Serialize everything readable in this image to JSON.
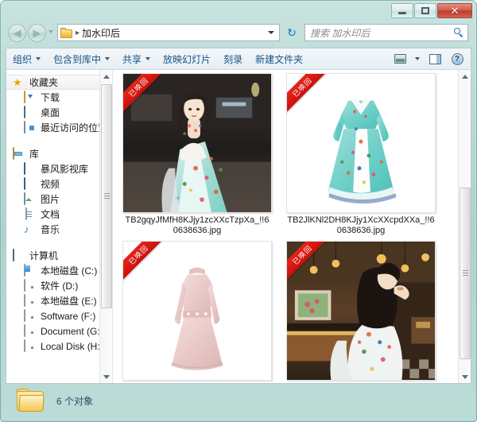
{
  "window": {
    "caption_buttons": {
      "minimize": "—",
      "maximize": "❐",
      "close": "✕"
    }
  },
  "address": {
    "back_glyph": "◀",
    "forward_glyph": "▶",
    "folder_icon": "folder-icon",
    "separator": "▸",
    "path": "加水印后",
    "refresh_glyph": "↻"
  },
  "search": {
    "placeholder": "搜索 加水印后",
    "value": "",
    "icon": "search-icon"
  },
  "toolbar": {
    "items": [
      {
        "label": "组织",
        "has_caret": true
      },
      {
        "label": "包含到库中",
        "has_caret": true
      },
      {
        "label": "共享",
        "has_caret": true
      },
      {
        "label": "放映幻灯片",
        "has_caret": false
      },
      {
        "label": "刻录",
        "has_caret": false
      },
      {
        "label": "新建文件夹",
        "has_caret": false
      }
    ],
    "view_icon": "view-options-icon",
    "view_caret": "chevron-down-icon",
    "preview_pane_icon": "preview-pane-icon",
    "help_icon": "help-icon",
    "help_label": "?"
  },
  "sidebar": {
    "groups": [
      {
        "header": {
          "label": "收藏夹",
          "icon": "star-icon",
          "selected": true
        },
        "items": [
          {
            "label": "下载",
            "icon": "downloads-icon"
          },
          {
            "label": "桌面",
            "icon": "desktop-icon"
          },
          {
            "label": "最近访问的位置",
            "icon": "recent-places-icon"
          }
        ]
      },
      {
        "header": {
          "label": "库",
          "icon": "library-icon",
          "selected": false
        },
        "items": [
          {
            "label": "暴风影视库",
            "icon": "video-library-icon"
          },
          {
            "label": "视频",
            "icon": "videos-icon"
          },
          {
            "label": "图片",
            "icon": "pictures-icon"
          },
          {
            "label": "文档",
            "icon": "documents-icon"
          },
          {
            "label": "音乐",
            "icon": "music-icon"
          }
        ]
      },
      {
        "header": {
          "label": "计算机",
          "icon": "computer-icon",
          "selected": false
        },
        "items": [
          {
            "label": "本地磁盘 (C:)",
            "icon": "system-drive-icon"
          },
          {
            "label": "软件 (D:)",
            "icon": "drive-icon"
          },
          {
            "label": "本地磁盘 (E:)",
            "icon": "drive-icon"
          },
          {
            "label": "Software (F:)",
            "icon": "drive-icon"
          },
          {
            "label": "Document (G:)",
            "icon": "drive-icon"
          },
          {
            "label": "Local Disk (H:)",
            "icon": "drive-icon"
          }
        ]
      }
    ]
  },
  "files": {
    "items": [
      {
        "name": "TB2gqyJfMfH8KJjy1zcXXcTzpXa_!!60638636.jpg",
        "badge": "已唤回",
        "thumb": "model-floral-dress-street"
      },
      {
        "name": "TB2JlKNl2DH8KJjy1XcXXcpdXXa_!!60638636.jpg",
        "badge": "已唤回",
        "thumb": "turquoise-floral-dress-product"
      },
      {
        "name": "",
        "badge": "已唤回",
        "thumb": "pink-dress-product"
      },
      {
        "name": "",
        "badge": "已唤回",
        "thumb": "model-cafe-interior"
      }
    ]
  },
  "statusbar": {
    "icon": "folder-icon",
    "text": "6 个对象"
  },
  "colors": {
    "frame": "#b3d4cf",
    "close_button": "#c8352a",
    "accent_link": "#16548a",
    "ribbon": "#d8130c",
    "status_text": "#2a4a6a"
  }
}
